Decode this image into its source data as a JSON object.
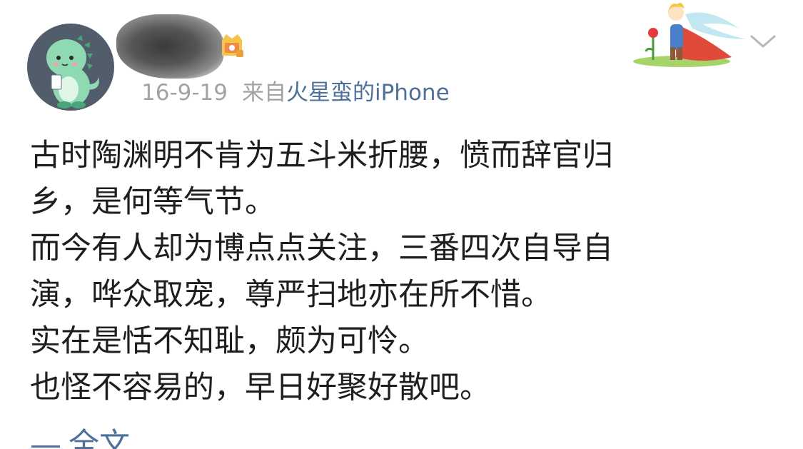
{
  "post": {
    "date": "16-9-19",
    "source_prefix": "来自",
    "source_device": "火星蛮的iPhone",
    "content_lines": [
      "古时陶渊明不肯为五斗米折腰，愤而辞官归",
      "乡，是何等气节。",
      "而今有人却为博点点关注，三番四次自导自",
      "演，哗众取宠，尊严扫地亦在所不惜。",
      "实在是恬不知耻，颇为可怜。",
      "也怪不容易的，早日好聚好散吧。"
    ],
    "full_text_label": "全文"
  },
  "icons": {
    "avatar": "dinosaur-avatar-icon",
    "vip": "vip-badge-icon",
    "decoration": "little-prince-decoration",
    "more": "chevron-down-icon"
  },
  "colors": {
    "link": "#4e6f9a",
    "meta_text": "#a3a3a3",
    "body_text": "#1e1e1e",
    "avatar_bg": "#525d6b"
  }
}
